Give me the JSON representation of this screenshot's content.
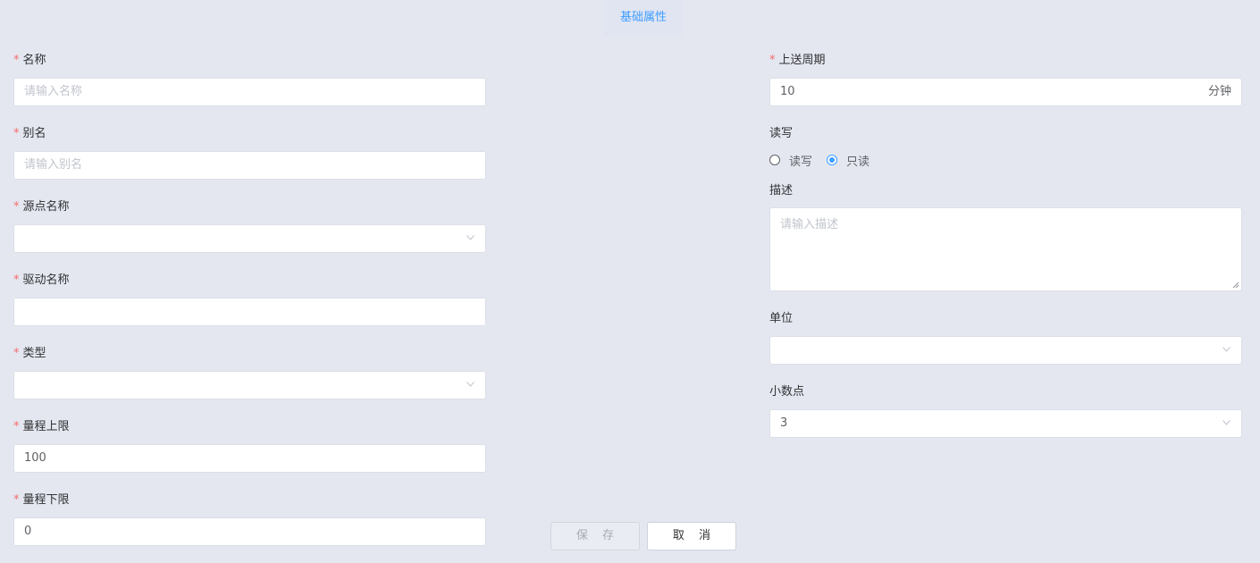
{
  "tab": {
    "title": "基础属性"
  },
  "left": {
    "name": {
      "label": "名称",
      "placeholder": "请输入名称"
    },
    "alias": {
      "label": "别名",
      "placeholder": "请输入别名"
    },
    "source_name": {
      "label": "源点名称",
      "value": ""
    },
    "driver_name": {
      "label": "驱动名称",
      "value": ""
    },
    "type": {
      "label": "类型",
      "value": ""
    },
    "range_upper": {
      "label": "量程上限",
      "value": "100"
    },
    "range_lower": {
      "label": "量程下限",
      "value": "0"
    }
  },
  "right": {
    "upload_period": {
      "label": "上送周期",
      "value": "10",
      "unit": "分钟"
    },
    "read_write": {
      "label": "读写",
      "options": [
        {
          "label": "读写",
          "checked": false
        },
        {
          "label": "只读",
          "checked": true
        }
      ]
    },
    "description": {
      "label": "描述",
      "placeholder": "请输入描述"
    },
    "unit": {
      "label": "单位",
      "value": ""
    },
    "decimal": {
      "label": "小数点",
      "value": "3"
    }
  },
  "footer": {
    "save_label": "保 存",
    "cancel_label": "取 消"
  },
  "colors": {
    "accent": "#409eff",
    "required": "#f56c6c",
    "background": "#e4e7f0"
  }
}
